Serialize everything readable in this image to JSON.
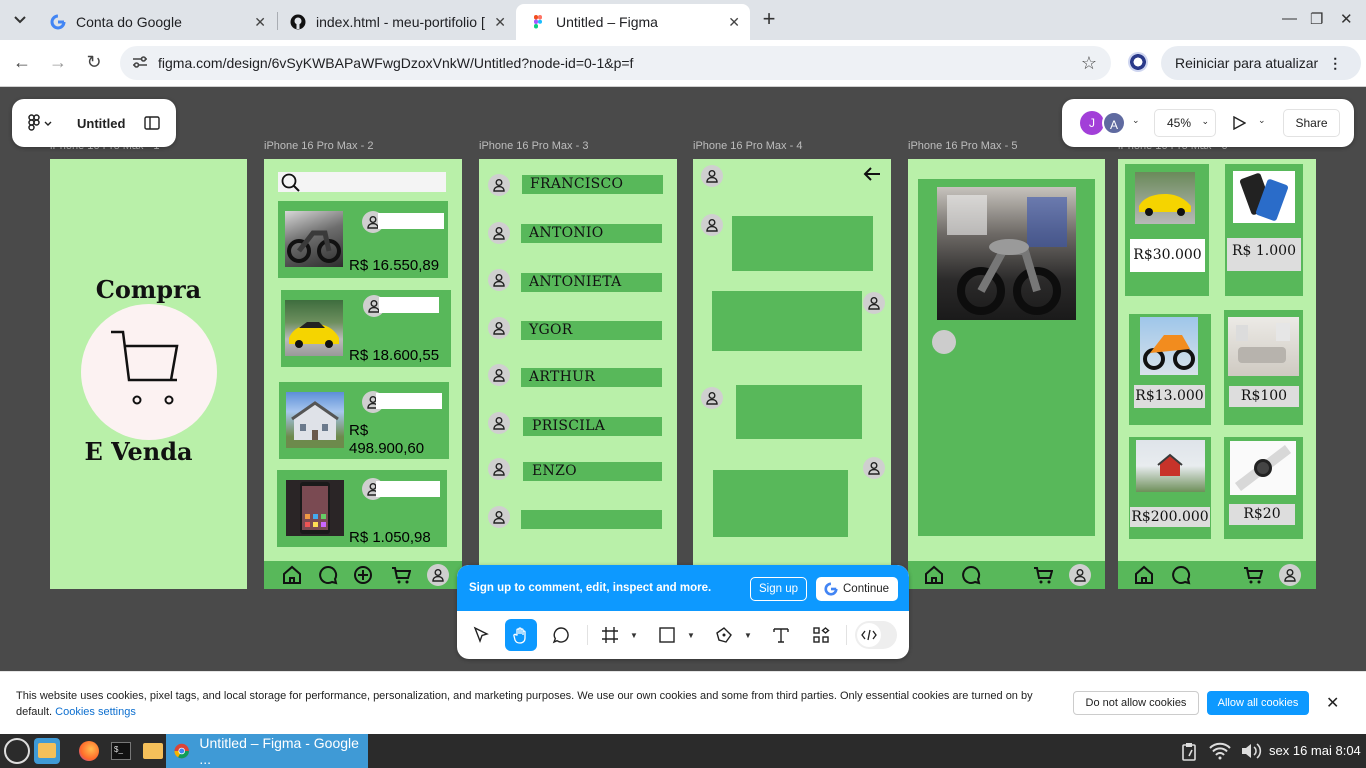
{
  "tabs": [
    {
      "title": "Conta do Google",
      "icon": "google-icon"
    },
    {
      "title": "index.html - meu-portifolio [",
      "icon": "github-icon"
    },
    {
      "title": "Untitled – Figma",
      "icon": "figma-icon",
      "active": true
    }
  ],
  "toolbar": {
    "url": "figma.com/design/6vSyKWBAPaWFwgDzoxVnkW/Untitled?node-id=0-1&p=f",
    "update_label": "Reiniciar para atualizar"
  },
  "figma": {
    "file_name": "Untitled",
    "avatars": [
      "J",
      "A"
    ],
    "zoom": "45%",
    "share_label": "Share",
    "signup_prompt": "Sign up to comment, edit, inspect and more.",
    "signup_label": "Sign up",
    "continue_label": "Continue",
    "frames": [
      {
        "label": "iPhone 16 Pro Max - 1"
      },
      {
        "label": "iPhone 16 Pro Max - 2"
      },
      {
        "label": "iPhone 16 Pro Max - 3"
      },
      {
        "label": "iPhone 16 Pro Max - 4"
      },
      {
        "label": "iPhone 16 Pro Max - 5"
      },
      {
        "label": "iPhone 16 Pro Max - 6"
      }
    ],
    "frame1": {
      "line1": "Compra",
      "line2": "E Venda"
    },
    "frame2": {
      "prices": [
        "R$ 16.550,89",
        "R$ 18.600,55",
        "R$\n498.900,60",
        "R$ 1.050,98"
      ]
    },
    "frame3": {
      "names": [
        "FRANCISCO",
        "ANTONIO",
        "ANTONIETA",
        "YGOR",
        "ARTHUR",
        "PRISCILA",
        "ENZO",
        ""
      ]
    },
    "frame6": {
      "prices": [
        "R$30.000",
        "R$ 1.000",
        "R$13.000",
        "R$100",
        "R$200.000",
        "R$20"
      ]
    }
  },
  "cookie": {
    "text": "This website uses cookies, pixel tags, and local storage for performance, personalization, and marketing purposes. We use our own cookies and some from third parties. Only essential cookies are turned on by default.",
    "settings_link": "Cookies settings",
    "deny_label": "Do not allow cookies",
    "allow_label": "Allow all cookies"
  },
  "taskbar": {
    "window_title": "Untitled – Figma - Google ...",
    "clock": "sex 16 mai  8:04"
  },
  "colors": {
    "frame_bg": "#b9f0a9",
    "frame_accent": "#58b85a",
    "figma_blue": "#0d99ff"
  }
}
